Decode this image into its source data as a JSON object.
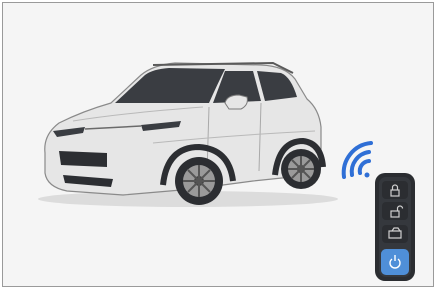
{
  "scene": {
    "subject": "car-illustration",
    "accessory": "remote-key-fob"
  },
  "colors": {
    "background": "#f5f5f5",
    "frame_border": "#9a9a9a",
    "car_body": "#e6e6e6",
    "car_glass": "#3a3d42",
    "car_dark": "#2c2e32",
    "wireless_signal": "#2f6fd6",
    "key_body": "#2b2d31",
    "key_highlight": "#4f8fd8"
  },
  "icons": {
    "signal": "wireless-signal-icon",
    "key_buttons": [
      "lock-icon",
      "unlock-icon",
      "trunk-icon",
      "remote-start-icon"
    ]
  }
}
